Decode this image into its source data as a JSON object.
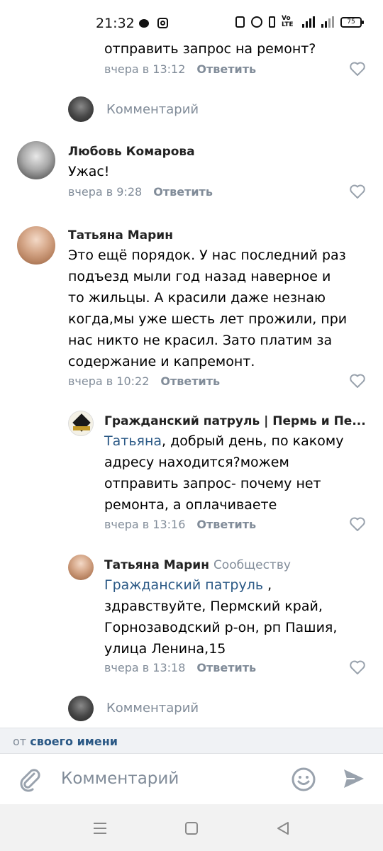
{
  "status_bar": {
    "time": "21:32",
    "battery": "75"
  },
  "comments": {
    "prev_text": "отправить запрос на ремонт?",
    "prev_date": "вчера в 13:12",
    "reply_label": "Ответить",
    "comment_placeholder": "Комментарий",
    "c1": {
      "author": "Любовь Комарова",
      "text": "Ужас!",
      "date": "вчера в 9:28"
    },
    "c2": {
      "author": "Татьяна Марин",
      "lines": [
        "Это ещё порядок. У нас последний раз",
        "подъезд мыли год назад наверное и",
        "то жильцы. А красили даже незнаю",
        "когда,мы уже шесть лет прожили, при",
        "нас никто не красил. Зато платим за",
        "содержание и капремонт."
      ],
      "date": "вчера в 10:22"
    },
    "r1": {
      "author": "Гражданский патруль | Пермь и Пе...",
      "mention": "Татьяна",
      "first_line_rest": ", добрый день, по какому",
      "lines": [
        "адресу находится?можем",
        "отправить запрос- почему нет",
        "ремонта, а оплачиваете"
      ],
      "date": "вчера в 13:16"
    },
    "r2": {
      "author": "Татьяна Марин",
      "author_suffix": "Сообществу",
      "mention": "Гражданский патруль",
      "first_line_rest": " ,",
      "lines": [
        "здравствуйте, Пермский край,",
        "Горнозаводский р-он, рп Пашия,",
        "улица Ленина,15"
      ],
      "date": "вчера в 13:18"
    }
  },
  "from_bar": {
    "prefix": "от",
    "link": "своего имени"
  },
  "input": {
    "placeholder": "Комментарий"
  },
  "colors": {
    "link": "#2a5885",
    "muted": "#818c99",
    "accent": "#99a2ad"
  }
}
